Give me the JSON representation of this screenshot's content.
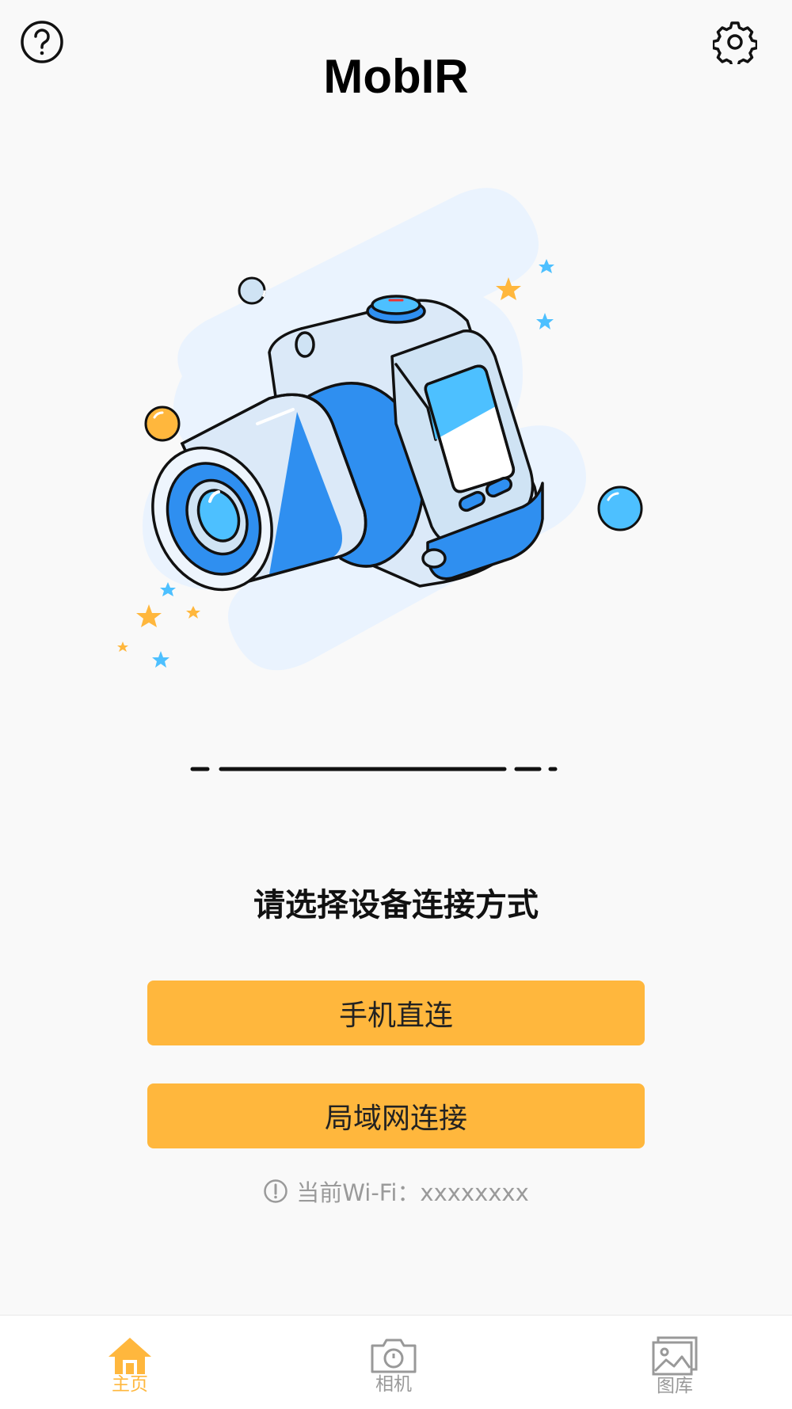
{
  "header": {
    "title": "MobIR",
    "help_icon": "question-circle-icon",
    "settings_icon": "gear-icon"
  },
  "main": {
    "prompt": "请选择设备连接方式",
    "buttons": {
      "direct": "手机直连",
      "lan": "局域网连接"
    },
    "wifi": {
      "icon": "info-circle-icon",
      "label": "当前Wi-Fi：xxxxxxxx"
    }
  },
  "tabbar": {
    "tabs": [
      {
        "label": "主页",
        "icon": "home-icon",
        "active": true
      },
      {
        "label": "相机",
        "icon": "camera-icon",
        "active": false
      },
      {
        "label": "图库",
        "icon": "gallery-icon",
        "active": false
      }
    ]
  },
  "colors": {
    "accent": "#ffb73d",
    "illustration_blue": "#2f8ff0",
    "light_blue": "#4dc0ff",
    "background": "#f9f9f9"
  }
}
